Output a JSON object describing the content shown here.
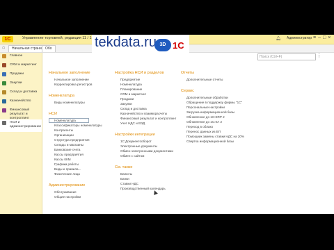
{
  "app": {
    "title": "Управление торговлей, редакция 11 / 1С:Предприятие",
    "user": "Администратор",
    "logo": "1С"
  },
  "watermark": {
    "text": "tekdata.ru",
    "badge": "3D",
    "logo": "1C"
  },
  "tabs": [
    {
      "label": "Начальная страница"
    },
    {
      "label": "Обо"
    }
  ],
  "search": {
    "placeholder": "Поиск (Ctrl+F)"
  },
  "sidebar": {
    "items": [
      {
        "label": "Главное",
        "color": "#c78b2c"
      },
      {
        "label": "CRM и маркетинг",
        "color": "#9a4a2a"
      },
      {
        "label": "Продажи",
        "color": "#3a6fb5"
      },
      {
        "label": "Закупки",
        "color": "#3a8a3a"
      },
      {
        "label": "Склад и доставка",
        "color": "#b58a2a"
      },
      {
        "label": "Казначейство",
        "color": "#2a6a9a"
      },
      {
        "label": "Финансовый результат и контроллинг",
        "color": "#8a3a8a"
      },
      {
        "label": "НСИ и администрирование",
        "color": "#6a6a6a"
      }
    ]
  },
  "col1": [
    {
      "type": "h",
      "text": "Начальное заполнение"
    },
    {
      "type": "i",
      "text": "Начальное заполнение"
    },
    {
      "type": "i",
      "text": "Корректировка регистров"
    },
    {
      "type": "s"
    },
    {
      "type": "h",
      "text": "Номенклатура"
    },
    {
      "type": "i",
      "text": "Виды номенклатуры"
    },
    {
      "type": "s"
    },
    {
      "type": "h",
      "text": "НСИ"
    },
    {
      "type": "i",
      "text": "Номенклатура",
      "sel": true
    },
    {
      "type": "i",
      "text": "Классификаторы номенклатуры"
    },
    {
      "type": "i",
      "text": "Контрагенты"
    },
    {
      "type": "i",
      "text": "Организации"
    },
    {
      "type": "i",
      "text": "Структура предприятия"
    },
    {
      "type": "i",
      "text": "Склады и магазины"
    },
    {
      "type": "i",
      "text": "Банковские счета"
    },
    {
      "type": "i",
      "text": "Кассы предприятия"
    },
    {
      "type": "i",
      "text": "Кассы ККМ"
    },
    {
      "type": "i",
      "text": "Графики работы"
    },
    {
      "type": "i",
      "text": "Виды и правила..."
    },
    {
      "type": "i",
      "text": "Физические лица"
    },
    {
      "type": "s"
    },
    {
      "type": "h",
      "text": "Администрирование"
    },
    {
      "type": "i",
      "text": "Обслуживание"
    },
    {
      "type": "i",
      "text": "Общие настройки"
    }
  ],
  "col2": [
    {
      "type": "h",
      "text": "Настройка НСИ и разделов"
    },
    {
      "type": "i",
      "text": "Предприятие"
    },
    {
      "type": "i",
      "text": "Номенклатура"
    },
    {
      "type": "i",
      "text": "Планирование"
    },
    {
      "type": "i",
      "text": "CRM и маркетинг"
    },
    {
      "type": "i",
      "text": "Продажи"
    },
    {
      "type": "i",
      "text": "Закупки"
    },
    {
      "type": "i",
      "text": "Склад и доставка"
    },
    {
      "type": "i",
      "text": "Казначейство и взаиморасчеты"
    },
    {
      "type": "i",
      "text": "Финансовый результат и контроллинг"
    },
    {
      "type": "i",
      "text": "Учет НДС и ВЭД"
    },
    {
      "type": "s"
    },
    {
      "type": "h",
      "text": "Настройки интеграции"
    },
    {
      "type": "i",
      "text": "1С:Документооборот"
    },
    {
      "type": "i",
      "text": "Электронные документы"
    },
    {
      "type": "i",
      "text": "Обмен электронными документами"
    },
    {
      "type": "i",
      "text": "Обмен с сайтом"
    },
    {
      "type": "s"
    },
    {
      "type": "h",
      "text": "См. также"
    },
    {
      "type": "i",
      "text": "Валюты"
    },
    {
      "type": "i",
      "text": "Банки"
    },
    {
      "type": "i",
      "text": "Ставки НДС"
    },
    {
      "type": "i",
      "text": "Производственный календарь"
    }
  ],
  "col3": [
    {
      "type": "h",
      "text": "Отчеты"
    },
    {
      "type": "i",
      "text": "Дополнительные отчеты"
    },
    {
      "type": "s"
    },
    {
      "type": "h",
      "text": "Сервис"
    },
    {
      "type": "i",
      "text": "Дополнительные обработки"
    },
    {
      "type": "i",
      "text": "Обращение в поддержку фирмы \"1С\""
    },
    {
      "type": "i",
      "text": "Персональные настройки"
    },
    {
      "type": "i",
      "text": "Загрузка информационной базы"
    },
    {
      "type": "i",
      "text": "Обновление до 1С:ERP 2"
    },
    {
      "type": "i",
      "text": "Обновление до 1С:КА 2"
    },
    {
      "type": "i",
      "text": "Переход в облако"
    },
    {
      "type": "i",
      "text": "Перенос данных из БП"
    },
    {
      "type": "i",
      "text": "Помощник замены ставки НДС на 20%"
    },
    {
      "type": "i",
      "text": "Свертка информационной базы"
    }
  ]
}
